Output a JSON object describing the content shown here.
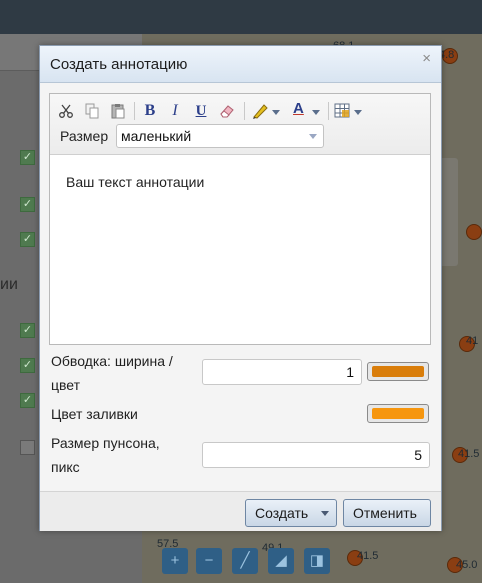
{
  "background": {
    "map_labels": [
      "68.1",
      "4.8",
      "41",
      "41.5",
      "45.0",
      "57.5",
      "49.1",
      "41.5"
    ],
    "side_text": "ии"
  },
  "dialog": {
    "title": "Создать аннотацию",
    "close_glyph": "×",
    "toolbar": {
      "icons": [
        "cut-icon",
        "copy-icon",
        "paste-icon",
        "bold-icon",
        "italic-icon",
        "underline-icon",
        "eraser-icon",
        "highlighter-icon",
        "font-color-icon",
        "insert-table-icon"
      ],
      "bold": "B",
      "italic": "I",
      "underline": "U",
      "font_color": "A",
      "size_label": "Размер",
      "size_value": "маленький"
    },
    "editor_text": "Ваш текст аннотации",
    "stroke": {
      "label_line1": "Обводка: ширина /",
      "label_line2": "цвет",
      "width_value": "1",
      "color": "#d97d0a"
    },
    "fill": {
      "label": "Цвет заливки",
      "color": "#f6960e"
    },
    "punch": {
      "label_line1": "Размер пунсона,",
      "label_line2": "пикс",
      "value": "5"
    },
    "buttons": {
      "create": "Создать",
      "cancel": "Отменить"
    }
  }
}
